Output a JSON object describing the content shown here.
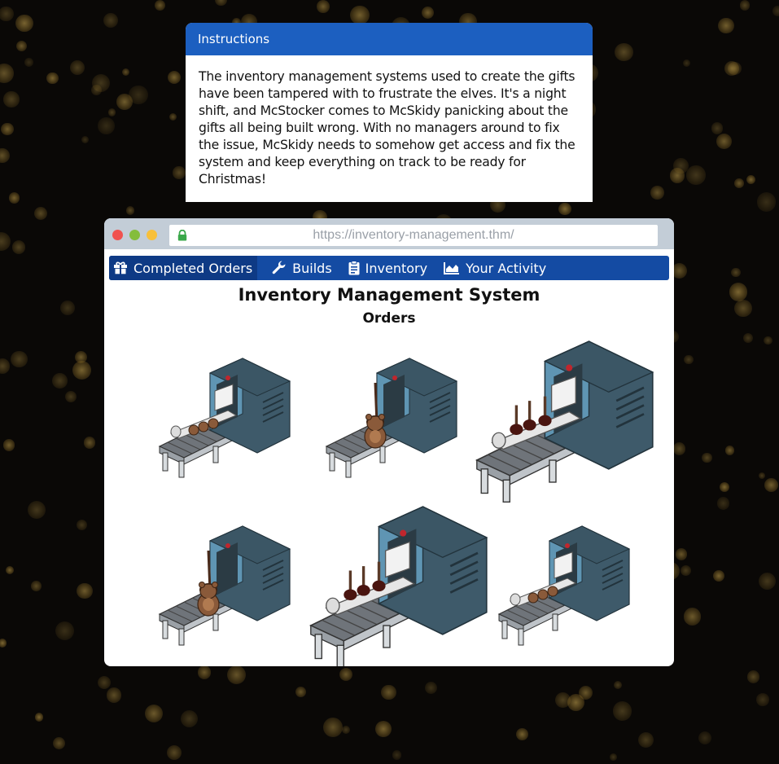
{
  "instructions": {
    "heading": "Instructions",
    "text": "The inventory management systems used to create the gifts have been tampered with to frustrate the elves. It's a night shift, and McStocker comes to McSkidy panicking about the gifts all being built wrong. With no managers around to fix the issue, McSkidy needs to somehow get access and fix the system and keep everything on track to be ready for Christmas!"
  },
  "browser": {
    "url": "https://inventory-management.thm/"
  },
  "nav": {
    "items": [
      {
        "label": "Completed Orders",
        "icon": "gift-icon",
        "active": true
      },
      {
        "label": "Builds",
        "icon": "wrench-icon"
      },
      {
        "label": "Inventory",
        "icon": "clipboard-icon"
      },
      {
        "label": "Your Activity",
        "icon": "area-chart-icon"
      }
    ]
  },
  "page": {
    "title": "Inventory Management System",
    "subtitle": "Orders"
  },
  "orders": [
    {
      "item": "train-with-bears",
      "size": "small"
    },
    {
      "item": "teddy-bear",
      "size": "small"
    },
    {
      "item": "train-with-plungers",
      "size": "large"
    },
    {
      "item": "teddy-bear",
      "size": "small"
    },
    {
      "item": "train-with-plungers",
      "size": "large"
    },
    {
      "item": "train-with-bears",
      "size": "small"
    }
  ],
  "colors": {
    "header_blue": "#1c5fc0",
    "nav_blue": "#144ba3",
    "nav_active": "#0e3a85",
    "lock_green": "#3aa84a"
  }
}
